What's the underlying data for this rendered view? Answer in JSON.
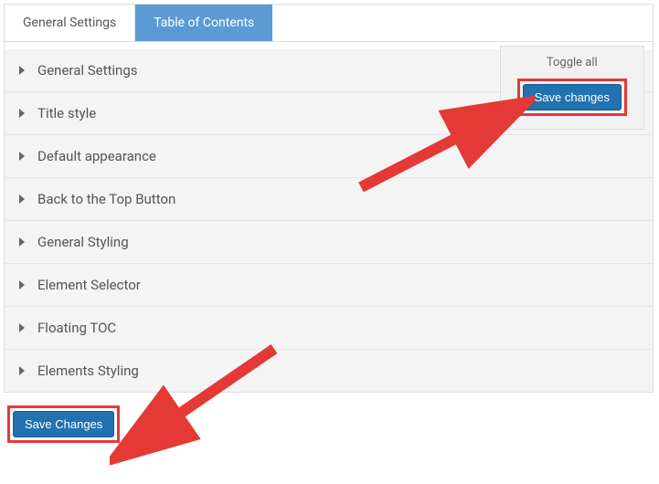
{
  "tabs": [
    {
      "label": "General Settings"
    },
    {
      "label": "Table of Contents"
    }
  ],
  "sections": [
    {
      "label": "General Settings"
    },
    {
      "label": "Title style"
    },
    {
      "label": "Default appearance"
    },
    {
      "label": "Back to the Top Button"
    },
    {
      "label": "General Styling"
    },
    {
      "label": "Element Selector"
    },
    {
      "label": "Floating TOC"
    },
    {
      "label": "Elements Styling"
    }
  ],
  "toggle": {
    "label": "Toggle all",
    "save_label": "Save changes"
  },
  "bottom": {
    "save_label": "Save Changes"
  }
}
